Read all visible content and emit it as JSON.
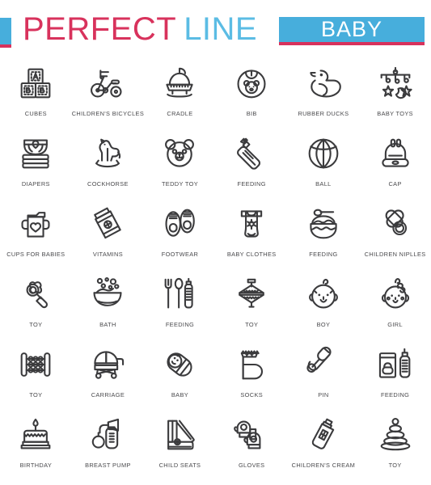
{
  "header": {
    "brand_primary": "PERFECT",
    "brand_secondary": "LINE",
    "badge_label": "BABY",
    "colors": {
      "pink": "#D8325C",
      "blue": "#47AEDC",
      "light_blue": "#5BBCE4",
      "icon_stroke": "#3B3B3D",
      "label_text": "#4A4A4D",
      "background": "#FFFFFF"
    }
  },
  "grid": {
    "columns": 6,
    "rows": 6,
    "items": [
      {
        "label": "CUBES",
        "icon": "alphabet-blocks-icon"
      },
      {
        "label": "CHILDREN'S BICYCLES",
        "icon": "tricycle-icon"
      },
      {
        "label": "CRADLE",
        "icon": "cradle-icon"
      },
      {
        "label": "BIB",
        "icon": "bib-icon"
      },
      {
        "label": "RUBBER DUCKS",
        "icon": "rubber-duck-icon"
      },
      {
        "label": "BABY TOYS",
        "icon": "crib-mobile-icon"
      },
      {
        "label": "DIAPERS",
        "icon": "diaper-stack-icon"
      },
      {
        "label": "COCKHORSE",
        "icon": "rocking-horse-icon"
      },
      {
        "label": "TEDDY  TOY",
        "icon": "teddy-bear-face-icon"
      },
      {
        "label": "FEEDING",
        "icon": "baby-bottle-tilted-icon"
      },
      {
        "label": "BALL",
        "icon": "beach-ball-icon"
      },
      {
        "label": "CAP",
        "icon": "bunny-cap-icon"
      },
      {
        "label": "CUPS FOR BABIES",
        "icon": "sippy-cup-icon"
      },
      {
        "label": "VITAMINS",
        "icon": "vitamin-jar-icon"
      },
      {
        "label": "FOOTWEAR",
        "icon": "baby-booties-icon"
      },
      {
        "label": "BABY CLOTHES",
        "icon": "onesie-icon"
      },
      {
        "label": "FEEDING",
        "icon": "food-bowl-spoon-icon"
      },
      {
        "label": "CHILDREN NIPLLES",
        "icon": "pacifier-icon"
      },
      {
        "label": "TOY",
        "icon": "rattle-flower-icon"
      },
      {
        "label": "BATH",
        "icon": "bathtub-bubbles-icon"
      },
      {
        "label": "FEEDING",
        "icon": "fork-spoon-bottle-icon"
      },
      {
        "label": "TOY",
        "icon": "spinning-top-icon"
      },
      {
        "label": "BOY",
        "icon": "baby-boy-face-icon"
      },
      {
        "label": "GIRL",
        "icon": "baby-girl-face-icon"
      },
      {
        "label": "TOY",
        "icon": "abacus-icon"
      },
      {
        "label": "CARRIAGE",
        "icon": "pram-icon"
      },
      {
        "label": "BABY",
        "icon": "swaddled-baby-icon"
      },
      {
        "label": "SOCKS",
        "icon": "baby-sock-icon"
      },
      {
        "label": "PIN",
        "icon": "safety-pin-icon"
      },
      {
        "label": "FEEDING",
        "icon": "formula-box-bottle-icon"
      },
      {
        "label": "BIRTHDAY",
        "icon": "birthday-cake-icon"
      },
      {
        "label": "BREAST PUMP",
        "icon": "breast-pump-icon"
      },
      {
        "label": "CHILD SEATS",
        "icon": "car-seat-icon"
      },
      {
        "label": "GLOVES",
        "icon": "baby-mittens-icon"
      },
      {
        "label": "CHILDREN'S CREAM",
        "icon": "cream-tube-icon"
      },
      {
        "label": "TOY",
        "icon": "stacking-rings-icon"
      }
    ]
  }
}
